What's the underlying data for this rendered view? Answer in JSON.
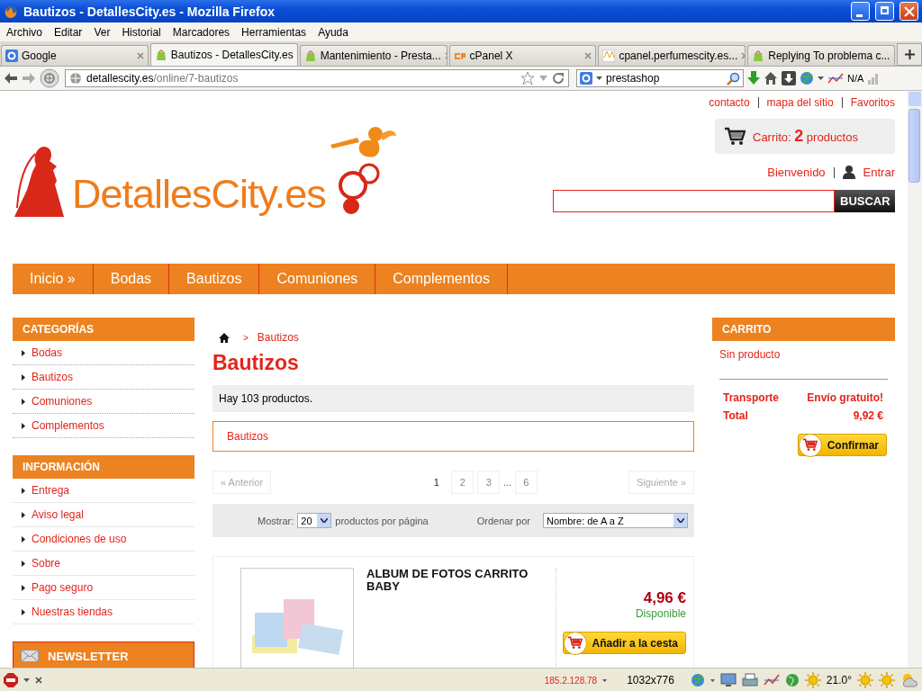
{
  "window": {
    "title": "Bautizos - DetallesCity.es - Mozilla Firefox"
  },
  "menu_bar": [
    "Archivo",
    "Editar",
    "Ver",
    "Historial",
    "Marcadores",
    "Herramientas",
    "Ayuda"
  ],
  "tabs": [
    {
      "label": "Google",
      "selected": false
    },
    {
      "label": "Bautizos - DetallesCity.es",
      "selected": true
    },
    {
      "label": "Mantenimiento - Presta...",
      "selected": false
    },
    {
      "label": "cPanel X",
      "selected": false
    },
    {
      "label": "cpanel.perfumescity.es...",
      "selected": false
    },
    {
      "label": "Replying To problema c...",
      "selected": false
    }
  ],
  "address_bar": {
    "domain": "detallescity.es",
    "path": "/online/7-bautizos"
  },
  "search_field": {
    "value": "prestashop"
  },
  "toolbar_status": "N/A",
  "page": {
    "top_links": [
      "contacto",
      "mapa del sitio",
      "Favoritos"
    ],
    "cart_summary": {
      "label": "Carrito:",
      "count": "2",
      "unit": "productos"
    },
    "welcome": "Bienvenido",
    "login": "Entrar",
    "logo_text": "DetallesCity.es",
    "search_button": "BUSCAR",
    "nav": [
      "Inicio »",
      "Bodas",
      "Bautizos",
      "Comuniones",
      "Complementos"
    ],
    "categories": {
      "title": "CATEGORÍAS",
      "items": [
        "Bodas",
        "Bautizos",
        "Comuniones",
        "Complementos"
      ]
    },
    "information": {
      "title": "INFORMACIÓN",
      "items": [
        "Entrega",
        "Aviso legal",
        "Condiciones de uso",
        "Sobre",
        "Pago seguro",
        "Nuestras tiendas"
      ]
    },
    "newsletter": {
      "title": "NEWSLETTER"
    },
    "breadcrumb": {
      "separator": ">",
      "current": "Bautizos"
    },
    "heading": "Bautizos",
    "product_count": "Hay 103 productos.",
    "subcategory": "Bautizos",
    "pagination": {
      "previous": "« Anterior",
      "next": "Siguiente »",
      "pages": [
        {
          "kind": "page",
          "label": "1",
          "selected": true
        },
        {
          "kind": "page",
          "label": "2",
          "selected": false
        },
        {
          "kind": "page",
          "label": "3",
          "selected": false
        },
        {
          "kind": "gap",
          "label": "..."
        },
        {
          "kind": "page",
          "label": "6",
          "selected": false
        }
      ]
    },
    "sort_bar": {
      "show_label": "Mostrar:",
      "per_page": "20",
      "per_page_suffix": "productos por página",
      "order_label": "Ordenar por",
      "order_value": "Nombre: de A a Z"
    },
    "products": [
      {
        "name": "ALBUM DE FOTOS CARRITO BABY",
        "price": "4,96 €",
        "availability": "Disponible",
        "button": "Añadir a la cesta"
      }
    ],
    "cart_block": {
      "title": "CARRITO",
      "empty_text": "Sin producto",
      "rows": [
        {
          "label": "Transporte",
          "value": "Envío gratuito!"
        },
        {
          "label": "Total",
          "value": "9,92 €"
        }
      ],
      "button": "Confirmar"
    }
  },
  "status_bar": {
    "ip": "185.2.128.78",
    "resolution": "1032x776",
    "temperature": "21.0°"
  }
}
